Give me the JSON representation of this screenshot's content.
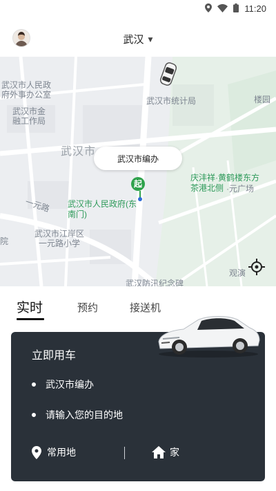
{
  "status_bar": {
    "time": "11:20",
    "icons": [
      "location-icon",
      "wifi-icon",
      "battery-icon"
    ]
  },
  "header": {
    "city": "武汉"
  },
  "map": {
    "labels": {
      "l1": "武汉市人民政",
      "l2": "府外事办公室",
      "l3": "武汉市金",
      "l4": "融工作局",
      "l5": "武汉市统计局",
      "l6": "楼园",
      "l7": "武汉市",
      "l8": "庆沣祥·黄鹤楼东方",
      "l9": "茶港北侧",
      "l10": "·元广场",
      "l11": "一元路",
      "l12": "武汉市人民政府(东",
      "l13": "南门)",
      "l14": "武汉市江岸区",
      "l15": "一元路小学",
      "l16": "院",
      "l17": "观演",
      "l18": "武汉防汛纪念碑"
    },
    "pickup_bubble": "武汉市编办",
    "pickup_marker": "起"
  },
  "tabs": [
    "实时",
    "预约",
    "接送机"
  ],
  "card": {
    "title": "立即用车",
    "origin": "武汉市编办",
    "destination_placeholder": "请输入您的目的地",
    "shortcuts": {
      "frequent": "常用地",
      "home": "家"
    }
  },
  "colors": {
    "card_bg": "#2a3139",
    "pin_green": "#2fa24c",
    "map_green_label": "#2e9a5a"
  }
}
